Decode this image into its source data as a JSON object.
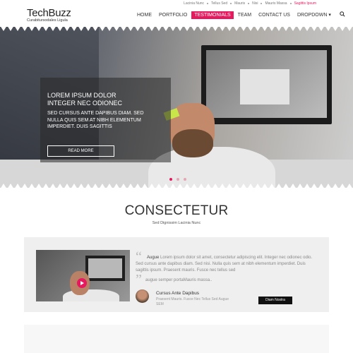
{
  "colors": {
    "accent": "#e6195f",
    "dark": "#111111"
  },
  "top_links": [
    {
      "label": "Lacinia Nunc",
      "active": false
    },
    {
      "label": "Tellus Sed",
      "active": false
    },
    {
      "label": "Mauris",
      "active": false
    },
    {
      "label": "Nisi",
      "active": false
    },
    {
      "label": "Mauris Massa",
      "active": false
    },
    {
      "label": "Sagittis Ipsum",
      "active": true
    }
  ],
  "brand": {
    "title": "TechBuzz",
    "tagline": "Curabitursodales Ligula"
  },
  "nav": {
    "items": [
      "HOME",
      "PORTFOLIO",
      "TESTIMONIALS",
      "TEAM",
      "CONTACT US",
      "DROPDOWN"
    ],
    "active_index": 2,
    "dropdown_caret": "▾",
    "search_icon": "search-icon"
  },
  "hero": {
    "title": "LOREM IPSUM DOLOR INTEGER NEC ODIONEC",
    "description": "SED CURSUS ANTE DAPIBUS DIAM. SED NULLA QUIS SEM AT NIBH ELEMENTUM IMPERDIET. DUIS SAGITTIS",
    "button": "READ MORE",
    "slides": 3,
    "active_slide": 0
  },
  "section": {
    "title": "CONSECTETUR",
    "subtitle": "Sed Dignissim Lacinia Nunc"
  },
  "testimonial": {
    "lead": "Augue",
    "text": " Lorem ipsum dolor sit amet, consectetur adipiscing elit. Integer nec odionec odio. Sed cursus ante dapibus diam. Sed nisi. Nulla quis sem at nibh elementum imperdiet. Duis sagittis ipsum. Praesent mauris. Fusce nec tellus sed",
    "tail": "augue semper portaMauris massa..",
    "author_name": "Cursus Ante Dapibus",
    "author_role": "Praesent Mauris. Fusce Nec Tellus Sed Augue SEM",
    "button": "Diam Nostra"
  }
}
